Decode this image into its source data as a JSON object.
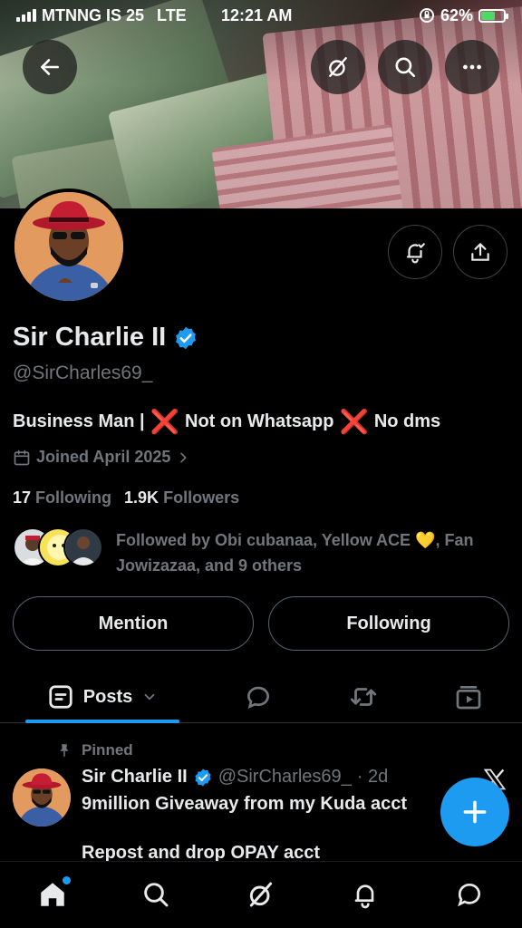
{
  "status_bar": {
    "carrier": "MTNNG IS 25",
    "network": "LTE",
    "time": "12:21 AM",
    "battery": "62%",
    "battery_level": 0.62
  },
  "header": {
    "back_icon": "back-arrow-icon",
    "grok_icon": "grok-icon",
    "search_icon": "search-icon",
    "more_icon": "more-icon"
  },
  "profile": {
    "name": "Sir Charlie II",
    "verified": true,
    "handle": "@SirCharles69_",
    "bio_1": "Business Man |",
    "bio_x": "❌",
    "bio_2": "Not on Whatsapp",
    "bio_3": "No dms",
    "joined": "Joined April 2025",
    "following_count": "17",
    "following_label": "Following",
    "followers_count": "1.9K",
    "followers_label": "Followers",
    "followed_by": "Followed by Obi cubanaa, Yellow ACE 💛, Fan Jowizazaa, and 9 others"
  },
  "actions": {
    "mention": "Mention",
    "following": "Following"
  },
  "tabs": {
    "posts": "Posts"
  },
  "pinned_post": {
    "pinned_label": "Pinned",
    "name": "Sir Charlie II",
    "handle": "@SirCharles69_",
    "time": "· 2d",
    "line1": "9million Giveaway from my Kuda acct",
    "line2": "Repost and drop OPAY acct"
  },
  "colors": {
    "accent": "#1d9bf0",
    "verified": "#1d9bf0",
    "red_x": "#f4212e"
  }
}
